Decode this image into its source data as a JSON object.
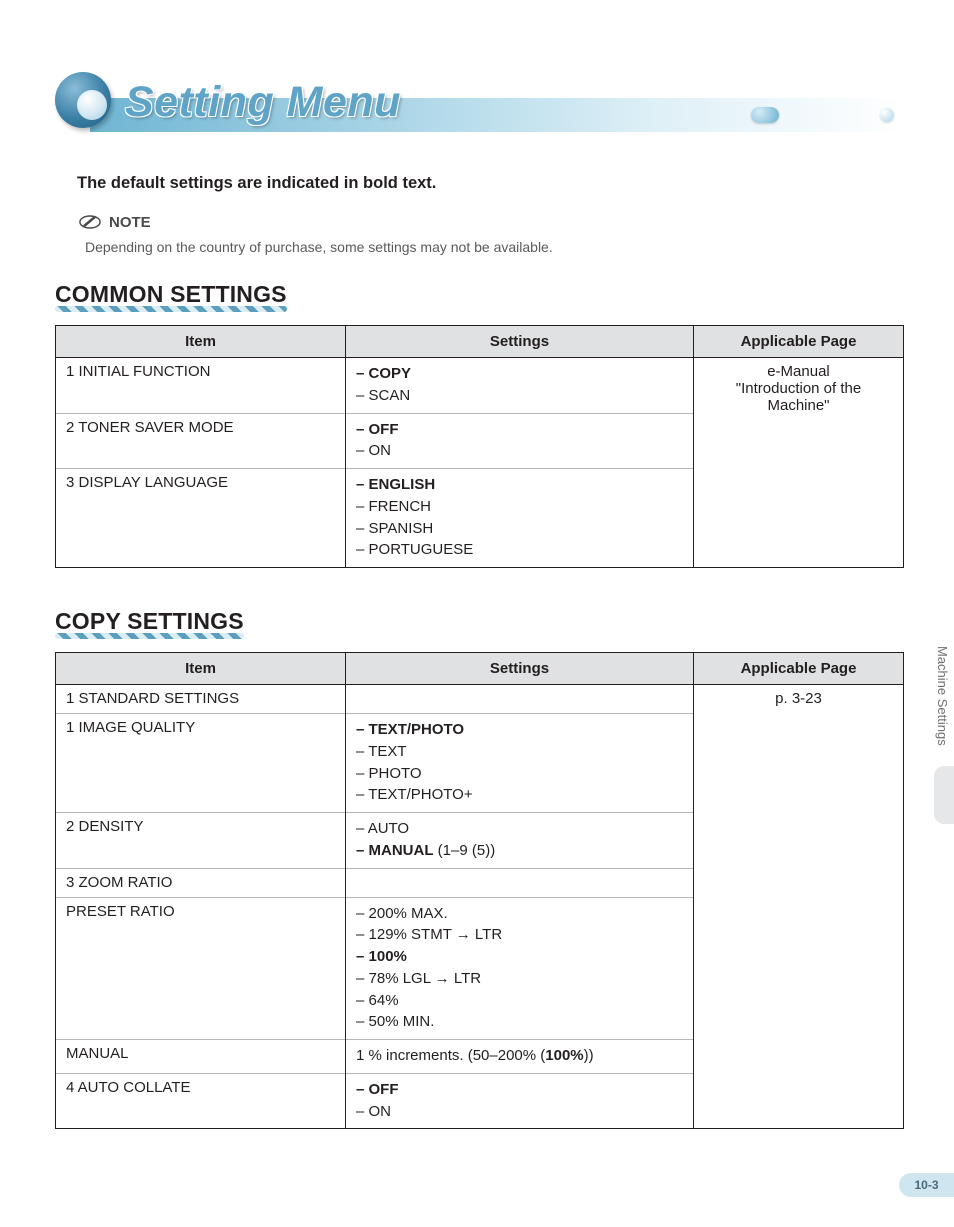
{
  "title": "Setting Menu",
  "default_note": "The default settings are indicated in bold text.",
  "note_label": "NOTE",
  "note_text": "Depending on the country of purchase, some settings may not be available.",
  "side_tab": "Machine Settings",
  "page_number": "10-3",
  "headers": {
    "item": "Item",
    "settings": "Settings",
    "applicable": "Applicable Page"
  },
  "common": {
    "heading": "COMMON SETTINGS",
    "applicable": "e-Manual \"Introduction of the Machine\"",
    "rows": [
      {
        "item": "1 INITIAL FUNCTION",
        "options": [
          {
            "text": "COPY",
            "bold": true
          },
          {
            "text": "SCAN",
            "bold": false
          }
        ]
      },
      {
        "item": "2 TONER SAVER MODE",
        "options": [
          {
            "text": "OFF",
            "bold": true
          },
          {
            "text": "ON",
            "bold": false
          }
        ]
      },
      {
        "item": "3 DISPLAY LANGUAGE",
        "options": [
          {
            "text": "ENGLISH",
            "bold": true
          },
          {
            "text": "FRENCH",
            "bold": false
          },
          {
            "text": "SPANISH",
            "bold": false
          },
          {
            "text": "PORTUGUESE",
            "bold": false
          }
        ]
      }
    ]
  },
  "copy": {
    "heading": "COPY SETTINGS",
    "applicable": "p. 3-23",
    "rows": [
      {
        "item": "1 STANDARD SETTINGS",
        "indent": 0,
        "settings_plain": "",
        "options": null
      },
      {
        "item": "1 IMAGE QUALITY",
        "indent": 1,
        "options": [
          {
            "text": "TEXT/PHOTO",
            "bold": true
          },
          {
            "text": "TEXT",
            "bold": false
          },
          {
            "text": "PHOTO",
            "bold": false
          },
          {
            "text": "TEXT/PHOTO+",
            "bold": false
          }
        ]
      },
      {
        "item": "2 DENSITY",
        "indent": 1,
        "options": [
          {
            "text": "AUTO",
            "bold": false
          },
          {
            "text": "MANUAL",
            "bold": true,
            "extra": " (1–9 (5))"
          }
        ]
      },
      {
        "item": "3 ZOOM RATIO",
        "indent": 1,
        "settings_plain": "",
        "options": null
      },
      {
        "item": "PRESET RATIO",
        "indent": 2,
        "options": [
          {
            "text": "200% MAX.",
            "bold": false
          },
          {
            "text": "129% STMT → LTR",
            "bold": false
          },
          {
            "text": "100%",
            "bold": true
          },
          {
            "text": "78% LGL → LTR",
            "bold": false
          },
          {
            "text": "64%",
            "bold": false
          },
          {
            "text": "50% MIN.",
            "bold": false
          }
        ]
      },
      {
        "item": "MANUAL",
        "indent": 2,
        "settings_plain": "1 % increments. (50–200% (100%))",
        "settings_plain_bold_part": "100%",
        "options": null
      },
      {
        "item": "4 AUTO COLLATE",
        "indent": 1,
        "options": [
          {
            "text": "OFF",
            "bold": true
          },
          {
            "text": "ON",
            "bold": false
          }
        ]
      }
    ]
  }
}
